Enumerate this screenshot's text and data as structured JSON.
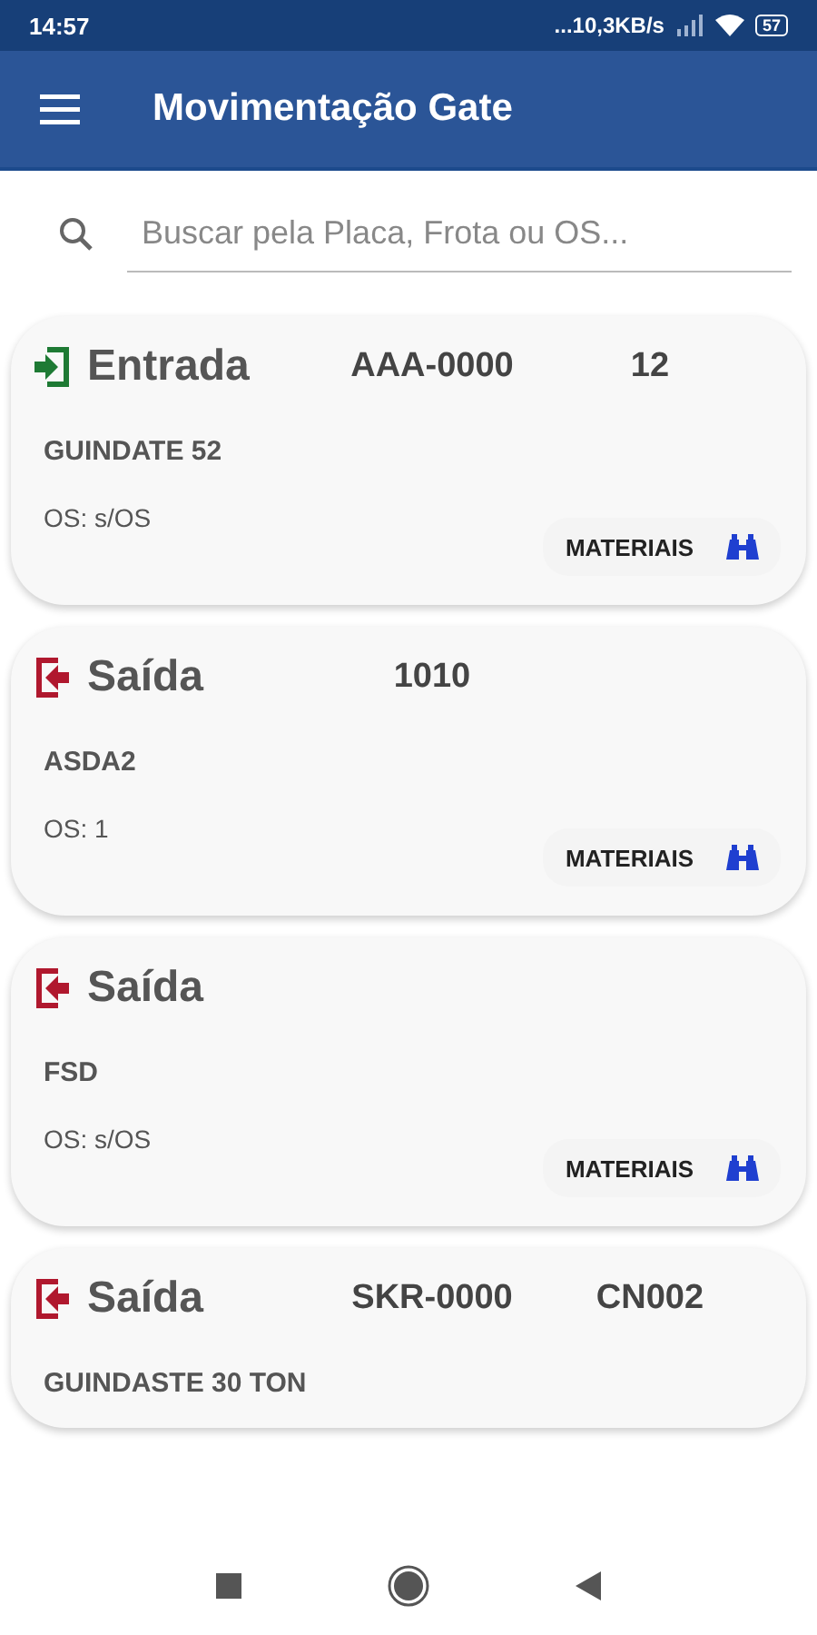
{
  "status_bar": {
    "time": "14:57",
    "network_speed": "...10,3KB/s",
    "battery": "57"
  },
  "app_bar": {
    "title": "Movimentação Gate"
  },
  "search": {
    "placeholder": "Buscar pela Placa, Frota ou OS..."
  },
  "cards": [
    {
      "kind": "entrada",
      "type_label": "Entrada",
      "plate": "AAA-0000",
      "fleet": "12",
      "name": "GUINDATE 52",
      "os": "OS: s/OS",
      "button": "MATERIAIS"
    },
    {
      "kind": "saida",
      "type_label": "Saída",
      "plate": "1010",
      "name": "ASDA2",
      "os": "OS: 1",
      "button": "MATERIAIS"
    },
    {
      "kind": "saida",
      "type_label": "Saída",
      "name": "FSD",
      "os": "OS: s/OS",
      "button": "MATERIAIS"
    },
    {
      "kind": "saida",
      "type_label": "Saída",
      "plate": "SKR-0000",
      "fleet": "CN002",
      "name": "GUINDASTE 30 TON"
    }
  ]
}
